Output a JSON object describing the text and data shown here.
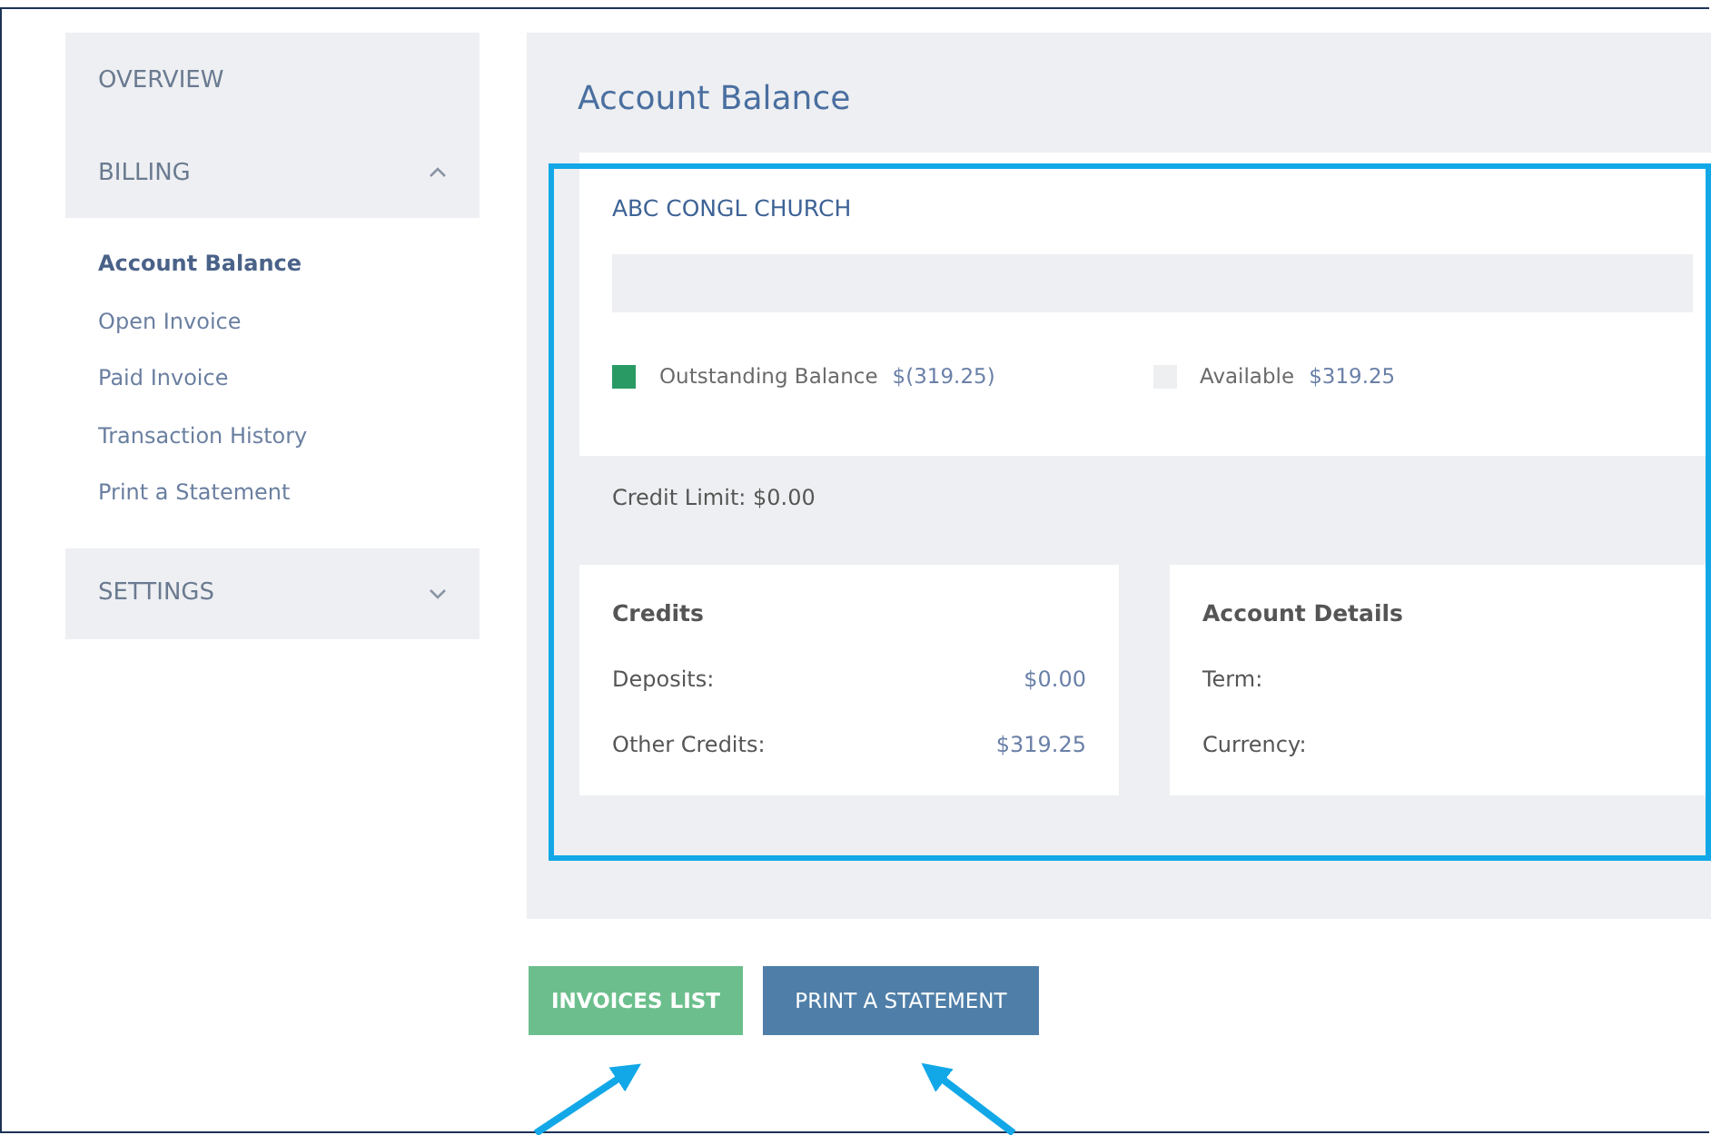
{
  "sidebar": {
    "sections": [
      {
        "label": "OVERVIEW"
      },
      {
        "label": "BILLING",
        "expanded": true,
        "items": [
          {
            "label": "Account Balance",
            "selected": true
          },
          {
            "label": "Open Invoice",
            "selected": false
          },
          {
            "label": "Paid Invoice",
            "selected": false
          },
          {
            "label": "Transaction History",
            "selected": false
          },
          {
            "label": "Print a Statement",
            "selected": false
          }
        ]
      },
      {
        "label": "SETTINGS",
        "expanded": false
      }
    ]
  },
  "main": {
    "title": "Account Balance",
    "account_name": "ABC CONGL CHURCH",
    "legend": [
      {
        "label": "Outstanding Balance",
        "value": "$(319.25)",
        "color": "#2a9a64"
      },
      {
        "label": "Available",
        "value": "$319.25",
        "color": "#eeeff1"
      }
    ],
    "credit_limit": "Credit Limit: $0.00",
    "credits": {
      "title": "Credits",
      "rows": [
        {
          "label": "Deposits:",
          "value": "$0.00"
        },
        {
          "label": "Other Credits:",
          "value": "$319.25"
        }
      ]
    },
    "account_details": {
      "title": "Account Details",
      "rows": [
        {
          "label": "Term:"
        },
        {
          "label": "Currency:"
        }
      ]
    }
  },
  "buttons": [
    {
      "label": "INVOICES LIST",
      "kind": "primary"
    },
    {
      "label": "PRINT A STATEMENT",
      "kind": "secondary"
    }
  ]
}
